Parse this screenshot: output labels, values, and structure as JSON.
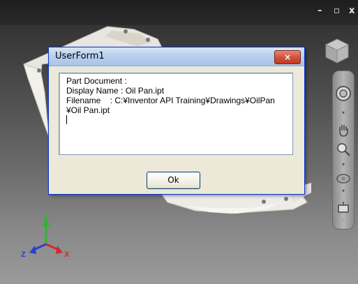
{
  "window_controls": {
    "minimize": "–",
    "restore": "▫",
    "close": "x"
  },
  "dialog": {
    "title": "UserForm1",
    "close_label": "×",
    "text_lines": [
      "Part Document :",
      "Display Name : Oil Pan.ipt",
      "Filename    : C:¥Inventor API Training¥Drawings¥OilPan",
      "¥Oil Pan.ipt"
    ],
    "ok_label": "Ok"
  },
  "triad": {
    "x_label": "X",
    "y_label": "Y",
    "z_label": "Z"
  },
  "colors": {
    "x_axis": "#d22a2a",
    "y_axis": "#2fb52f",
    "z_axis": "#2a3fd2",
    "dialog_border": "#0831d9"
  },
  "icons": {
    "viewcube": "viewcube-icon",
    "steering_wheel": "steering-wheel-icon",
    "pan": "pan-hand-icon",
    "zoom": "zoom-icon",
    "orbit": "orbit-icon",
    "look_at": "look-at-icon"
  }
}
